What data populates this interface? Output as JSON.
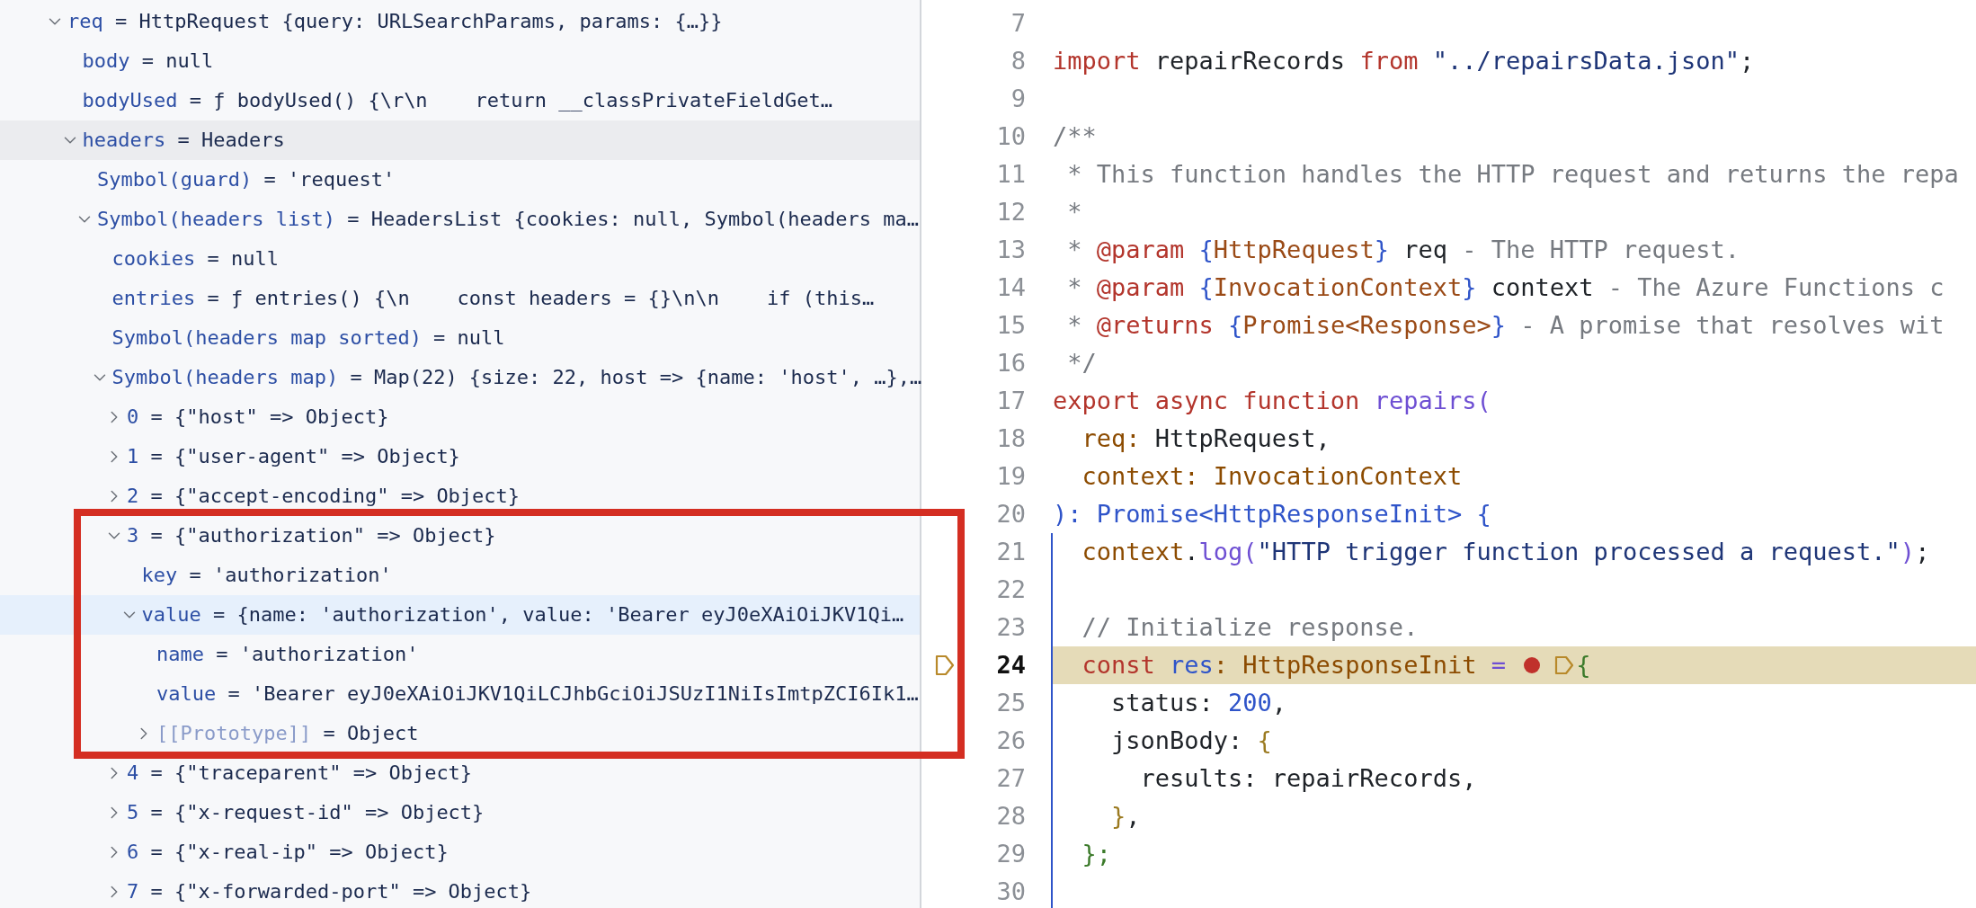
{
  "variables": {
    "tree": [
      {
        "name": "req",
        "value": "= HttpRequest {query: URLSearchParams, params: {…}}",
        "expanded": true,
        "selected": false,
        "children": [
          {
            "name": "body",
            "value": "= null",
            "selected": false
          },
          {
            "name": "bodyUsed",
            "value": "= ƒ bodyUsed() {\\r\\n    return __classPrivateFieldGet…",
            "selected": false
          },
          {
            "name": "headers",
            "value": "= Headers",
            "expanded": true,
            "hovered": true,
            "selected": false,
            "children": [
              {
                "name": "Symbol(guard)",
                "value": "= 'request'",
                "selected": false
              },
              {
                "name": "Symbol(headers list)",
                "value": "= HeadersList {cookies: null, Symbol(headers ma…",
                "expanded": true,
                "selected": false,
                "children": [
                  {
                    "name": "cookies",
                    "value": "= null",
                    "selected": false
                  },
                  {
                    "name": "entries",
                    "value": "= ƒ entries() {\\n    const headers = {}\\n\\n    if (this…",
                    "selected": false
                  },
                  {
                    "name": "Symbol(headers map sorted)",
                    "value": "= null",
                    "selected": false
                  },
                  {
                    "name": "Symbol(headers map)",
                    "value": "= Map(22) {size: 22, host => {name: 'host', …},…",
                    "expanded": true,
                    "selected": false,
                    "children": [
                      {
                        "name": "0",
                        "value": "= {\"host\" => Object}",
                        "expanded": false,
                        "selected": false
                      },
                      {
                        "name": "1",
                        "value": "= {\"user-agent\" => Object}",
                        "expanded": false,
                        "selected": false
                      },
                      {
                        "name": "2",
                        "value": "= {\"accept-encoding\" => Object}",
                        "expanded": false,
                        "selected": false
                      },
                      {
                        "name": "3",
                        "value": "= {\"authorization\" => Object}",
                        "expanded": true,
                        "boxed": true,
                        "selected": false,
                        "children": [
                          {
                            "name": "key",
                            "value": "= 'authorization'",
                            "selected": false
                          },
                          {
                            "name": "value",
                            "value": "= {name: 'authorization', value: 'Bearer eyJ0eXAiOiJKV1Qi…",
                            "expanded": true,
                            "selected": true,
                            "children": [
                              {
                                "name": "name",
                                "value": "= 'authorization'",
                                "selected": false
                              },
                              {
                                "name": "value",
                                "value": "= 'Bearer eyJ0eXAiOiJKV1QiLCJhbGciOiJSUzI1NiIsImtpZCI6Ik1…",
                                "selected": false
                              },
                              {
                                "name": "[[Prototype]]",
                                "value": "= Object",
                                "expanded": false,
                                "kind": "internal",
                                "selected": false
                              }
                            ]
                          }
                        ]
                      },
                      {
                        "name": "4",
                        "value": "= {\"traceparent\" => Object}",
                        "expanded": false,
                        "selected": false
                      },
                      {
                        "name": "5",
                        "value": "= {\"x-request-id\" => Object}",
                        "expanded": false,
                        "selected": false
                      },
                      {
                        "name": "6",
                        "value": "= {\"x-real-ip\" => Object}",
                        "expanded": false,
                        "selected": false
                      },
                      {
                        "name": "7",
                        "value": "= {\"x-forwarded-port\" => Object}",
                        "expanded": false,
                        "selected": false
                      }
                    ]
                  }
                ]
              }
            ]
          }
        ]
      }
    ]
  },
  "editor": {
    "lines": [
      {
        "number": "7"
      },
      {
        "number": "8",
        "tokens": [
          {
            "kind": "kw",
            "text": "import"
          },
          {
            "kind": "plain",
            "text": " repairRecords "
          },
          {
            "kind": "kw",
            "text": "from"
          },
          {
            "kind": "str",
            "text": " \"../repairsData.json\""
          },
          {
            "kind": "plain",
            "text": ";"
          }
        ]
      },
      {
        "number": "9"
      },
      {
        "number": "10",
        "tokens": [
          {
            "kind": "comment",
            "text": "/**"
          }
        ]
      },
      {
        "number": "11",
        "tokens": [
          {
            "kind": "comment",
            "text": " * This function handles the HTTP request and returns the repa"
          }
        ]
      },
      {
        "number": "12",
        "tokens": [
          {
            "kind": "comment",
            "text": " *"
          }
        ]
      },
      {
        "number": "13",
        "tokens": [
          {
            "kind": "comment",
            "text": " * "
          },
          {
            "kind": "doctag",
            "text": "@param "
          },
          {
            "kind": "brace",
            "text": "{"
          },
          {
            "kind": "type",
            "text": "HttpRequest"
          },
          {
            "kind": "brace",
            "text": "}"
          },
          {
            "kind": "plain",
            "text": " req"
          },
          {
            "kind": "comment",
            "text": " - The HTTP request."
          }
        ]
      },
      {
        "number": "14",
        "tokens": [
          {
            "kind": "comment",
            "text": " * "
          },
          {
            "kind": "doctag",
            "text": "@param "
          },
          {
            "kind": "brace",
            "text": "{"
          },
          {
            "kind": "type",
            "text": "InvocationContext"
          },
          {
            "kind": "brace",
            "text": "}"
          },
          {
            "kind": "plain",
            "text": " context"
          },
          {
            "kind": "comment",
            "text": " - The Azure Functions c"
          }
        ]
      },
      {
        "number": "15",
        "tokens": [
          {
            "kind": "comment",
            "text": " * "
          },
          {
            "kind": "doctag",
            "text": "@returns "
          },
          {
            "kind": "brace",
            "text": "{"
          },
          {
            "kind": "type",
            "text": "Promise<Response>"
          },
          {
            "kind": "brace",
            "text": "}"
          },
          {
            "kind": "comment",
            "text": " - A promise that resolves wit"
          }
        ]
      },
      {
        "number": "16",
        "tokens": [
          {
            "kind": "comment",
            "text": " */"
          }
        ]
      },
      {
        "number": "17",
        "tokens": [
          {
            "kind": "kw",
            "text": "export async function "
          },
          {
            "kind": "fn",
            "text": "repairs("
          }
        ]
      },
      {
        "number": "18",
        "tokens": [
          {
            "kind": "param",
            "text": "  req:"
          },
          {
            "kind": "plain",
            "text": " HttpRequest,"
          }
        ]
      },
      {
        "number": "19",
        "tokens": [
          {
            "kind": "param",
            "text": "  context: InvocationContext"
          }
        ]
      },
      {
        "number": "20",
        "tokens": [
          {
            "kind": "blue",
            "text": "): Promise<HttpResponseInit> {"
          }
        ]
      },
      {
        "number": "21",
        "scope": true,
        "tokens": [
          {
            "kind": "param",
            "text": "  context"
          },
          {
            "kind": "plain",
            "text": "."
          },
          {
            "kind": "fn",
            "text": "log("
          },
          {
            "kind": "str",
            "text": "\"HTTP trigger function processed a request.\""
          },
          {
            "kind": "fn",
            "text": ")"
          },
          {
            "kind": "plain",
            "text": ";"
          }
        ]
      },
      {
        "number": "22",
        "scope": true
      },
      {
        "number": "23",
        "scope": true,
        "tokens": [
          {
            "kind": "comment",
            "text": "  // Initialize response."
          }
        ]
      },
      {
        "number": "24",
        "scope": true,
        "current": true,
        "gutter_mark": true,
        "tokens": [
          {
            "kind": "kw",
            "text": "  const"
          },
          {
            "kind": "blue",
            "text": " res"
          },
          {
            "kind": "param",
            "text": ": HttpResponseInit"
          },
          {
            "kind": "fn",
            "text": " = "
          },
          {
            "kind": "dot"
          },
          {
            "kind": "tag"
          },
          {
            "kind": "green",
            "text": "{"
          }
        ]
      },
      {
        "number": "25",
        "scope": true,
        "tokens": [
          {
            "kind": "plain",
            "text": "    status: "
          },
          {
            "kind": "num",
            "text": "200"
          },
          {
            "kind": "plain",
            "text": ","
          }
        ]
      },
      {
        "number": "26",
        "scope": true,
        "tokens": [
          {
            "kind": "plain",
            "text": "    jsonBody: "
          },
          {
            "kind": "gold",
            "text": "{"
          }
        ]
      },
      {
        "number": "27",
        "scope": true,
        "tokens": [
          {
            "kind": "plain",
            "text": "      results: repairRecords,"
          }
        ]
      },
      {
        "number": "28",
        "scope": true,
        "tokens": [
          {
            "kind": "gold",
            "text": "    }"
          },
          {
            "kind": "plain",
            "text": ","
          }
        ]
      },
      {
        "number": "29",
        "scope": true,
        "tokens": [
          {
            "kind": "green",
            "text": "  };"
          }
        ]
      },
      {
        "number": "30",
        "scope": true
      }
    ]
  }
}
